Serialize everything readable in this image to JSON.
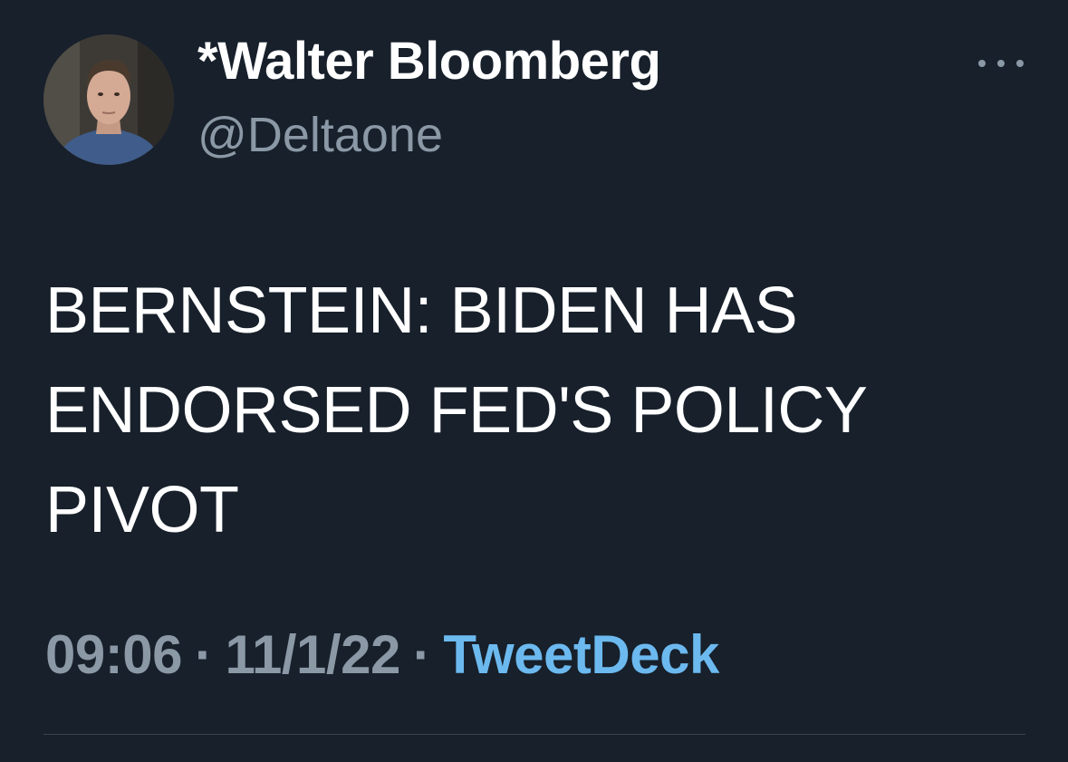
{
  "tweet": {
    "author": {
      "display_name": "*Walter Bloomberg",
      "handle": "@Deltaone"
    },
    "text": "BERNSTEIN: BIDEN HAS\nENDORSED FED'S POLICY\nPIVOT",
    "time": "09:06",
    "date": "11/1/22",
    "separator": "·",
    "source": "TweetDeck"
  },
  "icons": {
    "more": "more-options-icon"
  },
  "colors": {
    "background": "#17202b",
    "primary_text": "#ffffff",
    "secondary_text": "#8b98a5",
    "link": "#6cb9ef"
  }
}
